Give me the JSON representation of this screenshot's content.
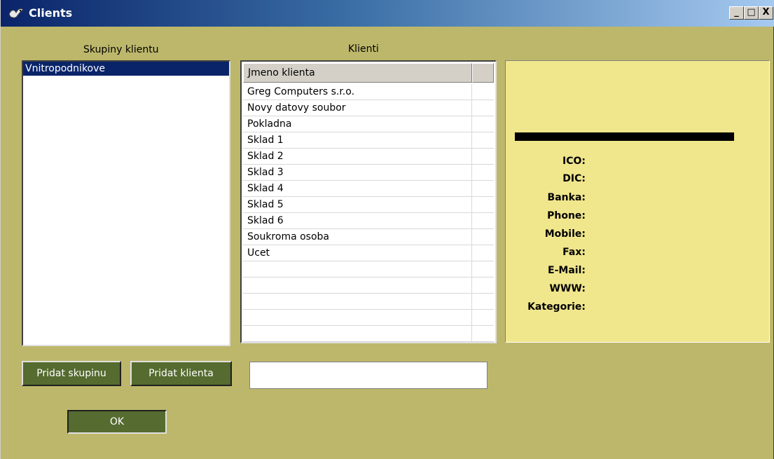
{
  "window": {
    "title": "Clients",
    "app_icon": "app-bird-icon"
  },
  "title_buttons": {
    "minimize": "_",
    "maximize": "□",
    "close": "X"
  },
  "groups": {
    "label": "Skupiny klientu",
    "items": [
      "Vnitropodnikove"
    ],
    "selected": "Vnitropodnikove"
  },
  "clients": {
    "label": "Klienti",
    "column_header": "Jmeno klienta",
    "rows": [
      "Greg Computers s.r.o.",
      "Novy datovy soubor",
      "Pokladna",
      "Sklad 1",
      "Sklad 2",
      "Sklad 3",
      "Sklad 4",
      "Sklad 5",
      "Sklad 6",
      "Soukroma osoba",
      "Ucet"
    ]
  },
  "details": {
    "ico_label": "ICO:",
    "dic_label": "DIC:",
    "banka_label": "Banka:",
    "phone_label": "Phone:",
    "mobile_label": "Mobile:",
    "fax_label": "Fax:",
    "email_label": "E-Mail:",
    "www_label": "WWW:",
    "kategorie_label": "Kategorie:"
  },
  "buttons": {
    "add_group": "Pridat skupinu",
    "add_client": "Pridat klienta",
    "ok": "OK"
  },
  "input": {
    "value": ""
  },
  "colors": {
    "window_bg": "#bdb76b",
    "detail_bg": "#f0e68c",
    "button_bg": "#556b2f",
    "selection": "#0a246a"
  }
}
